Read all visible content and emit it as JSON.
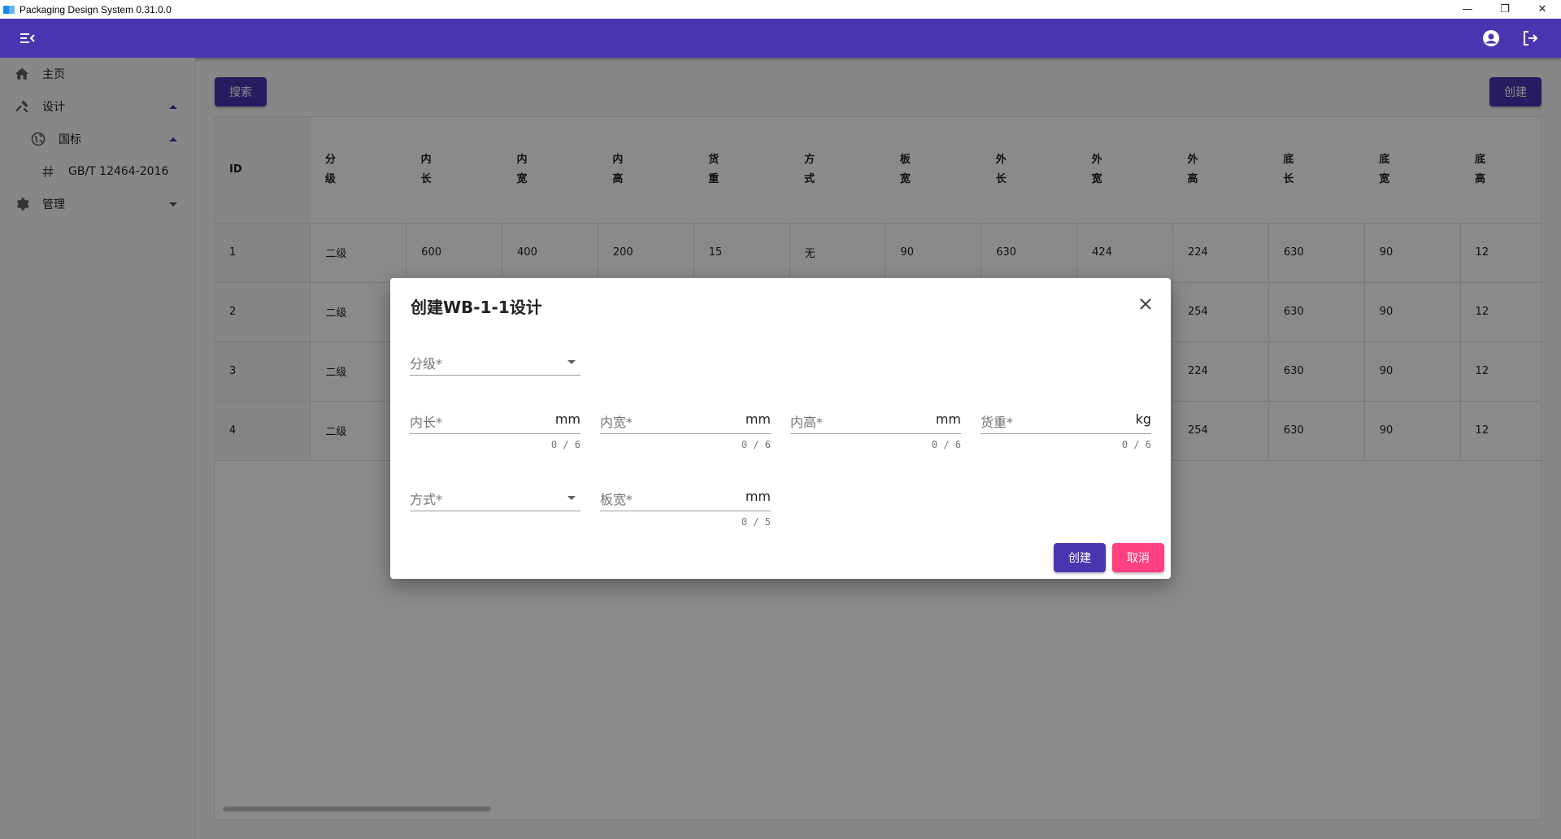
{
  "window": {
    "title": "Packaging Design System 0.31.0.0",
    "minimize": "—",
    "restore": "❐",
    "close": "✕"
  },
  "appbar": {
    "menu_icon": "menu-collapse-icon",
    "account_icon": "account-circle-icon",
    "logout_icon": "logout-icon",
    "color": "#4a35b1"
  },
  "sidebar": {
    "items": [
      {
        "label": "主页",
        "icon": "home-icon"
      },
      {
        "label": "设计",
        "icon": "tools-icon",
        "expanded": true
      },
      {
        "label": "国标",
        "icon": "globe-icon",
        "expanded": true
      },
      {
        "label": "GB/T 12464-2016",
        "icon": "hash-icon"
      },
      {
        "label": "管理",
        "icon": "gear-icon",
        "expanded": false
      }
    ]
  },
  "main": {
    "search_label": "搜索",
    "create_label": "创建"
  },
  "table": {
    "headers": [
      "ID",
      "分\n级",
      "内\n长",
      "内\n宽",
      "内\n高",
      "货\n重",
      "方\n式",
      "板\n宽",
      "外\n长",
      "外\n宽",
      "外\n高",
      "底\n长",
      "底\n宽",
      "底\n高"
    ],
    "rows": [
      [
        "1",
        "二级",
        "600",
        "400",
        "200",
        "15",
        "无",
        "90",
        "630",
        "424",
        "224",
        "630",
        "90",
        "12"
      ],
      [
        "2",
        "二级",
        "",
        "",
        "",
        "",
        "",
        "",
        "",
        "",
        "254",
        "630",
        "90",
        "12"
      ],
      [
        "3",
        "二级",
        "",
        "",
        "",
        "",
        "",
        "",
        "",
        "",
        "224",
        "630",
        "90",
        "12"
      ],
      [
        "4",
        "二级",
        "",
        "",
        "",
        "",
        "",
        "",
        "",
        "",
        "254",
        "630",
        "90",
        "12"
      ]
    ]
  },
  "dialog": {
    "title": "创建WB-1-1设计",
    "fields": {
      "grade": {
        "label": "分级*"
      },
      "inner_length": {
        "label": "内长*",
        "unit": "mm",
        "counter": "0 / 6"
      },
      "inner_width": {
        "label": "内宽*",
        "unit": "mm",
        "counter": "0 / 6"
      },
      "inner_height": {
        "label": "内高*",
        "unit": "mm",
        "counter": "0 / 6"
      },
      "cargo_weight": {
        "label": "货重*",
        "unit": "kg",
        "counter": "0 / 6"
      },
      "method": {
        "label": "方式*"
      },
      "board_width": {
        "label": "板宽*",
        "unit": "mm",
        "counter": "0 / 5"
      }
    },
    "create_label": "创建",
    "cancel_label": "取消",
    "create_color": "#4a35b1",
    "cancel_color": "#ff4081"
  }
}
